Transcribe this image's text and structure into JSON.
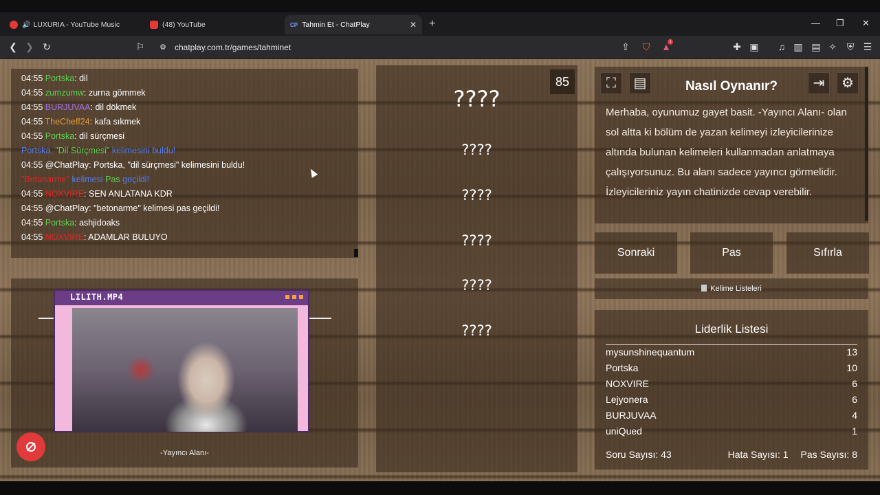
{
  "browser": {
    "tabs": [
      {
        "title": "LUXURIA - YouTube Music",
        "color": "#e53935"
      },
      {
        "title": "(48) YouTube",
        "color": "#e53935"
      },
      {
        "title": "Tahmin Et - ChatPlay",
        "color": "#7aa0ff",
        "fav_text": "CP"
      }
    ],
    "url": "chatplay.com.tr/games/tahminet",
    "ext_badge_count": "1"
  },
  "chat": {
    "lines": [
      {
        "time": "04:55",
        "user": "Portska",
        "msg": ": dil",
        "color": "green"
      },
      {
        "time": "04:55",
        "user": "zumzumw",
        "msg": ": zurna gömmek",
        "color": "green"
      },
      {
        "time": "04:55",
        "user": "BURJUVAA",
        "msg": ": dil dökmek",
        "color": "purple"
      },
      {
        "time": "04:55",
        "user": "TheCheff24",
        "msg": ": kafa sıkmek",
        "color": "orange"
      },
      {
        "time": "04:55",
        "user": "Portska",
        "msg": ": dil sürçmesi",
        "color": "green"
      }
    ],
    "found_notice": {
      "user": "Portska",
      "sep": ", ",
      "word": "\"Dil Sürçmesi\"",
      "text": " kelimesini buldu!"
    },
    "found_line": {
      "time": "04:55",
      "text": "@ChatPlay: Portska, \"dil sürçmesi\" kelimesini buldu!"
    },
    "pass_notice": {
      "word": "\"Betonarme\"",
      "text1": " kelimesi ",
      "pas": "Pas",
      "text2": " geçildi!"
    },
    "lines2": [
      {
        "time": "04:55",
        "user": "NOXVIRE",
        "msg": ": SEN ANLATANA KDR",
        "color": "red"
      },
      {
        "time": "04:55",
        "user": "",
        "msg": "@ChatPlay: \"betonarme\" kelimesi pas geçildi!",
        "color": ""
      },
      {
        "time": "04:55",
        "user": "Portska",
        "msg": ": ashjidoaks",
        "color": "green"
      },
      {
        "time": "04:55",
        "user": "NOXVIRE",
        "msg": ": ADAMLAR BULUYO",
        "color": "red"
      }
    ]
  },
  "streamer": {
    "video_title": "LILITH.MP4",
    "label": "-Yayıncı Alanı-"
  },
  "game": {
    "timer": "85",
    "words": [
      "????",
      "????",
      "????",
      "????",
      "????",
      "????"
    ]
  },
  "help": {
    "title": "Nasıl Oynanır?",
    "body": "Merhaba, oyunumuz gayet basit. -Yayıncı Alanı- olan sol altta ki bölüm de yazan kelimeyi izleyicilerinize altında bulunan kelimeleri kullanmadan anlatmaya çalışıyorsunuz. Bu alanı sadece yayıncı görmelidir. İzleyicileriniz yayın chatinizde cevap verebilir."
  },
  "controls": {
    "next": "Sonraki",
    "pass": "Pas",
    "reset": "Sıfırla",
    "word_lists": "Kelime Listeleri"
  },
  "leaderboard": {
    "title": "Liderlik Listesi",
    "rows": [
      {
        "name": "mysunshinequantum",
        "score": "13"
      },
      {
        "name": "Portska",
        "score": "10"
      },
      {
        "name": "NOXVIRE",
        "score": "6"
      },
      {
        "name": "Lejyonera",
        "score": "6"
      },
      {
        "name": "BURJUVAA",
        "score": "4"
      },
      {
        "name": "uniQued",
        "score": "1"
      }
    ],
    "question_count": "Soru Sayısı: 43",
    "error_count": "Hata Sayısı: 1",
    "pass_count": "Pas Sayısı: 8"
  }
}
